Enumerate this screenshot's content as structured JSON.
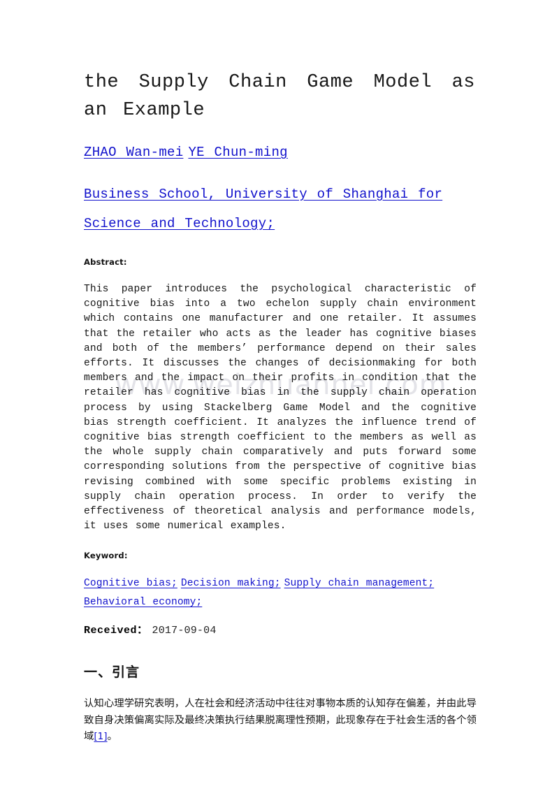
{
  "document": {
    "title": "the Supply Chain Game Model as an Example",
    "authors": [
      {
        "name": "ZHAO Wan-mei"
      },
      {
        "name": "YE Chun-ming"
      }
    ],
    "affiliation": "Business School, University of Shanghai for Science and Technology;",
    "abstract_label": "Abstract:",
    "abstract_text": "This paper introduces the psychological characteristic of cognitive bias into a two echelon supply chain environment which contains one manufacturer and one retailer. It assumes that the retailer who acts as the leader has cognitive biases and both of the members’ performance depend on their sales efforts. It discusses the changes of decisionmaking for both members and the impact on their profits in condition that the retailer has cognitive bias in the supply chain operation process by using Stackelberg Game Model and the cognitive bias strength coefficient. It analyzes the influence trend of cognitive bias strength coefficient to the members as well as the whole supply chain comparatively and puts forward some corresponding solutions from the perspective of cognitive bias revising combined with some specific problems existing in supply chain operation process. In order to verify the effectiveness of theoretical analysis and performance models, it uses some numerical examples.",
    "keyword_label": "Keyword:",
    "keywords": [
      "Cognitive bias;",
      "Decision making;",
      "Supply chain management;",
      "Behavioral economy;"
    ],
    "received_label": "Received：",
    "received_value": "2017-09-04",
    "section_heading": "一、引言",
    "section_body": "认知心理学研究表明，人在社会和经济活动中往往对事物本质的认知存在偏差，并由此导致自身决策偏离实际及最终决策执行结果脱离理性预期，此现象存在于社会生活的各个领域",
    "section_body_ref": "[1]",
    "section_body_tail": "。",
    "watermark": "www.weizhuannei.com",
    "colors": {
      "link": "#1111cc",
      "text": "#161616",
      "watermark": "#e3e3e8",
      "background": "#ffffff"
    }
  }
}
